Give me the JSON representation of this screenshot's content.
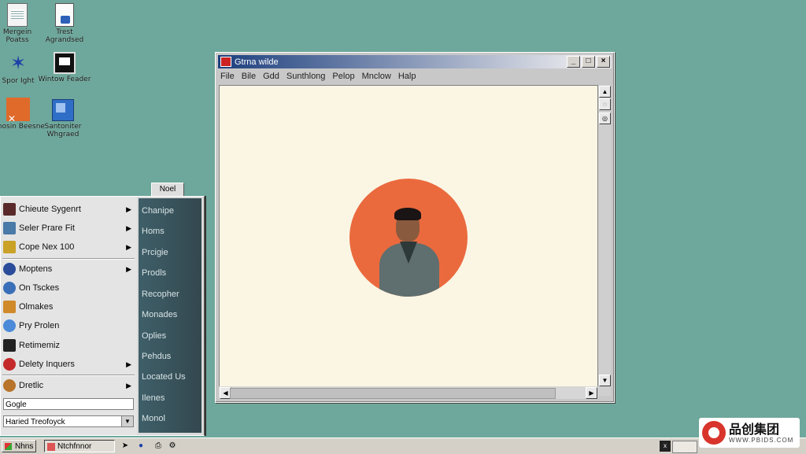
{
  "desktop": {
    "icons": [
      {
        "label": "Mergein Poatss",
        "icon": "document-icon"
      },
      {
        "label": "Trest Agrandsed",
        "icon": "document-icon"
      },
      {
        "label": "Spor Ight",
        "icon": "star-icon"
      },
      {
        "label": "Wintow Feader",
        "icon": "window-icon"
      },
      {
        "label": "Mnosin Beesne",
        "icon": "acrobat-icon"
      },
      {
        "label": "Santoniter Whgraed",
        "icon": "program-icon"
      }
    ]
  },
  "window": {
    "title": "Gtrna wilde",
    "menu": [
      "File",
      "Bile",
      "Gdd",
      "Sunthlong",
      "Pelop",
      "Mnclow",
      "Halp"
    ],
    "controls": {
      "minimize": "_",
      "maximize": "□",
      "close": "×"
    },
    "image": "portrait-in-orange-circle"
  },
  "start_menu": {
    "tab": "Noel",
    "left_items": [
      {
        "label": "Chieute Sygenrt",
        "arrow": true,
        "color": "#5a2a2a"
      },
      {
        "label": "Seler Prare Fit",
        "arrow": true,
        "color": "#4a7aa8"
      },
      {
        "label": "Cope Nex 100",
        "arrow": true,
        "color": "#c9a227"
      },
      {
        "label": "Moptens",
        "arrow": true,
        "color": "#2a4c9a"
      },
      {
        "label": "On Tsckes",
        "arrow": false,
        "color": "#3a6fb8"
      },
      {
        "label": "Olmakes",
        "arrow": false,
        "color": "#d08a2a"
      },
      {
        "label": "Pry Prolen",
        "arrow": false,
        "color": "#4a8ad8"
      },
      {
        "label": "Retimemiz",
        "arrow": false,
        "color": "#222222"
      },
      {
        "label": "Delety Inquers",
        "arrow": true,
        "color": "#c42a2a"
      },
      {
        "label": "Dretlic",
        "arrow": true,
        "color": "#b8742a"
      }
    ],
    "search_value": "Gogle",
    "select_value": "Haried Treofoyck",
    "right_items": [
      "Chanipe",
      "Homs",
      "Prcigie",
      "Prodls",
      "Recopher",
      "Monades",
      "Oplies",
      "Pehdus",
      "Located Us",
      "Ilenes",
      "Monol"
    ]
  },
  "taskbar": {
    "start_label": "Nhns",
    "task_label": "Ntchfnnor",
    "tray_box": "x"
  },
  "watermark": {
    "main": "品创集团",
    "sub": "WWW.PBIDS.COM"
  }
}
